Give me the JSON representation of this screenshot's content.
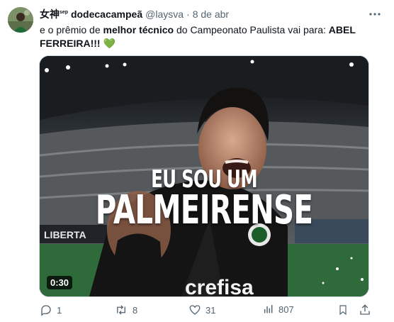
{
  "tweet": {
    "author_name": "女神",
    "author_sup": "sep",
    "author_name_rest": "dodecacampeã",
    "handle": "@laysva",
    "separator": "·",
    "date": "8 de abr",
    "text": {
      "part1": "e o prêmio de ",
      "bold1": "melhor técnico",
      "part2": " do Campeonato Paulista vai para: ",
      "bold2": "ABEL FERREIRA",
      "part3": "!!! ",
      "emoji": "💚"
    },
    "video": {
      "caption_line1": "EU SOU UM",
      "caption_line2": "PALMEIRENSE",
      "duration": "0:30",
      "banner_text": "LIBERTA",
      "shirt_text": "crefisa"
    },
    "actions": {
      "replies": "1",
      "reposts": "8",
      "likes": "31",
      "views": "807"
    }
  },
  "colors": {
    "text": "#0f1419",
    "secondary": "#536471",
    "border": "#cfd9de",
    "heart_green": "#2fae4e"
  }
}
